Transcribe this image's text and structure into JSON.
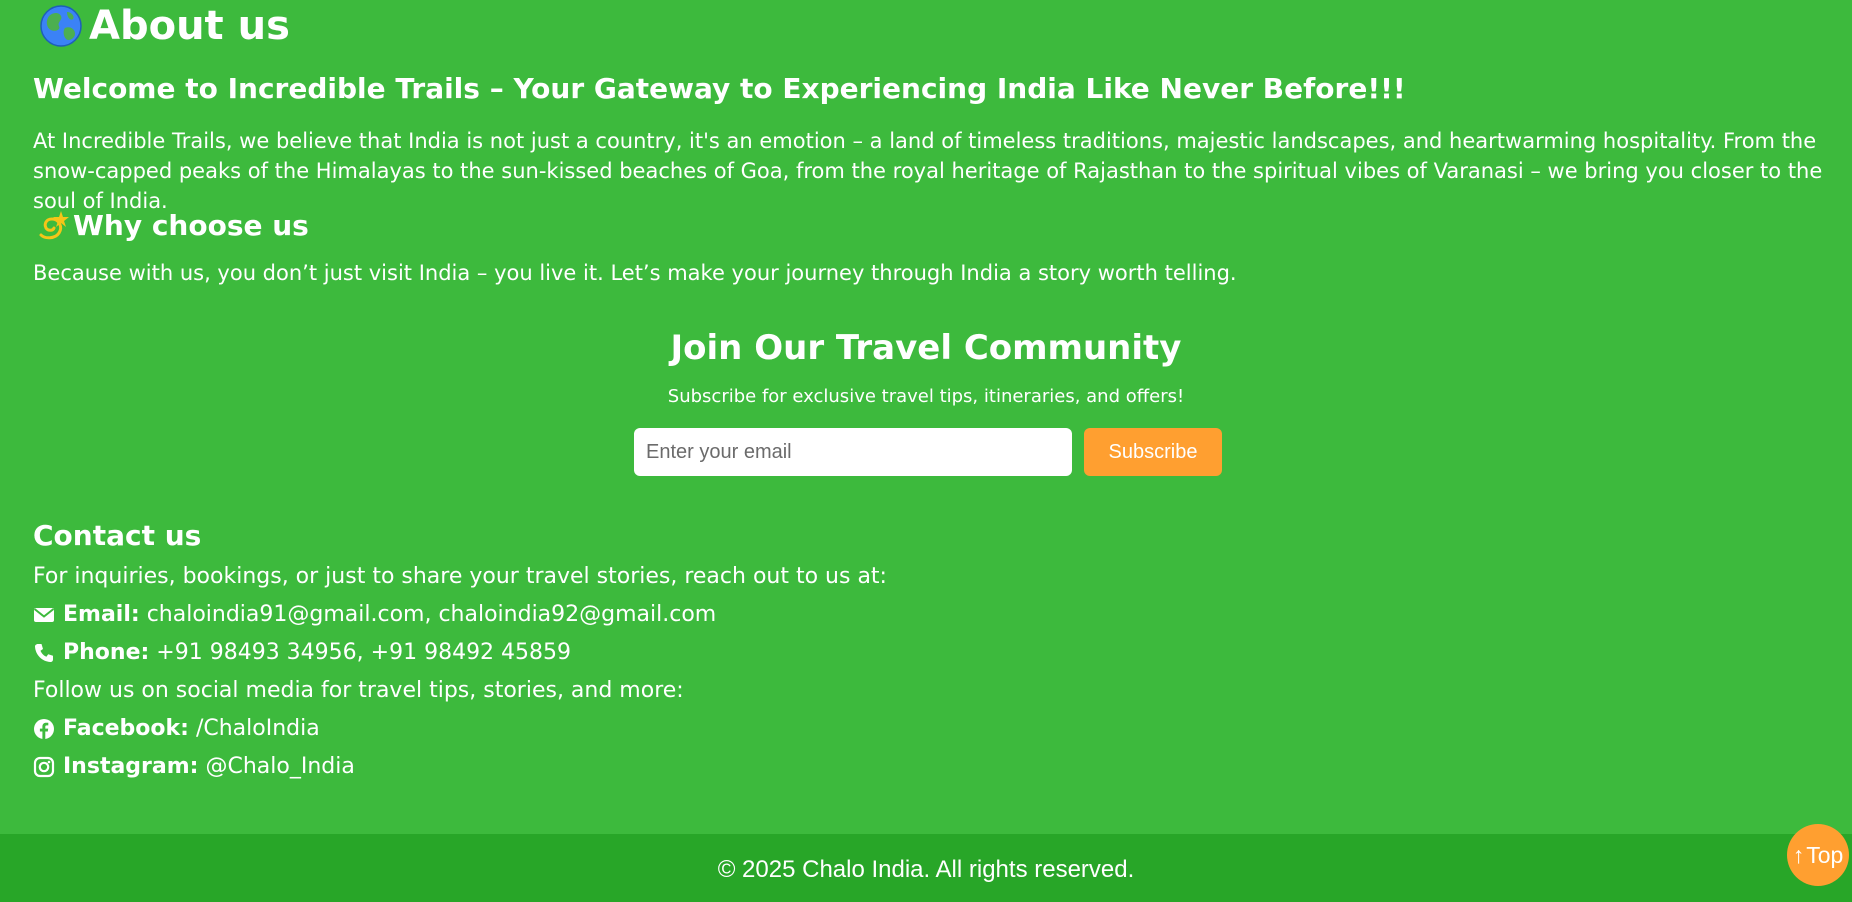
{
  "about": {
    "title": "About us",
    "title_icon": "globe-icon",
    "welcome_heading": "Welcome to Incredible Trails – Your Gateway to Experiencing India Like Never Before!!!",
    "intro_text": "At Incredible Trails, we believe that India is not just a country, it's an emotion – a land of timeless traditions, majestic landscapes, and heartwarming hospitality. From the snow-capped peaks of the Himalayas to the sun-kissed beaches of Goa, from the royal heritage of Rajasthan to the spiritual vibes of Varanasi – we bring you closer to the soul of India.",
    "why_title": "Why choose us",
    "why_icon": "dizzy-star-icon",
    "why_text": "Because with us, you don’t just visit India – you live it. Let’s make your journey through India a story worth telling."
  },
  "community": {
    "title": "Join Our Travel Community",
    "subtitle": "Subscribe for exclusive travel tips, itineraries, and offers!",
    "email_placeholder": "Enter your email",
    "email_value": "",
    "subscribe_label": "Subscribe"
  },
  "contact": {
    "title": "Contact us",
    "intro": "For inquiries, bookings, or just to share your travel stories, reach out to us at:",
    "email_label": "Email:",
    "email_value": "chaloindia91@gmail.com, chaloindia92@gmail.com",
    "phone_label": "Phone:",
    "phone_value": "+91 98493 34956, +91 98492 45859",
    "social_intro": "Follow us on social media for travel tips, stories, and more:",
    "facebook_label": "Facebook:",
    "facebook_value": "/ChaloIndia",
    "instagram_label": "Instagram:",
    "instagram_value": "@Chalo_India"
  },
  "footer": {
    "copyright": "© 2025 Chalo India. All rights reserved."
  },
  "scroll_top": {
    "arrow": "↑",
    "label": "Top"
  },
  "colors": {
    "background": "#3dba3d",
    "footer_background": "#28a628",
    "accent_orange": "#ff9f30",
    "text": "#ffffff"
  }
}
